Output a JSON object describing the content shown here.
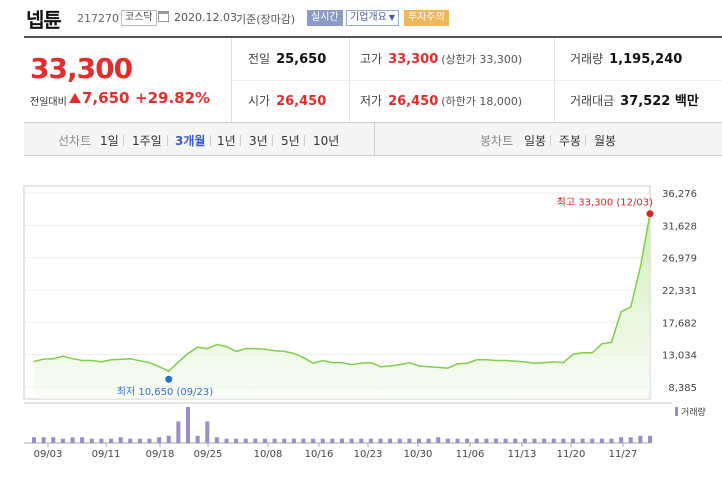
{
  "header": {
    "stock_name": "넵튠",
    "stock_code": "217270",
    "market": "코스닥",
    "as_of_date": "2020.12.03",
    "as_of_note": "기준(장마감)",
    "realtime_label": "실시간",
    "company_info_label": "기업개요",
    "warning_label": "투자주의"
  },
  "quote": {
    "current_price": "33,300",
    "change_label": "전일대비",
    "change_value": "7,650",
    "change_percent": "+29.82%",
    "prev_close_label": "전일",
    "prev_close": "25,650",
    "open_label": "시가",
    "open": "26,450",
    "high_label": "고가",
    "high": "33,300",
    "upper_limit": "(상한가 33,300)",
    "low_label": "저가",
    "low": "26,450",
    "lower_limit": "(하한가 18,000)",
    "volume_label": "거래량",
    "volume": "1,195,240",
    "amount_label": "거래대금",
    "amount": "37,522 백만"
  },
  "period_bar": {
    "line_label": "선차트",
    "line_tabs": [
      "1일",
      "1주일",
      "3개월",
      "1년",
      "3년",
      "5년",
      "10년"
    ],
    "active_tab": "3개월",
    "candle_label": "봉차트",
    "candle_tabs": [
      "일봉",
      "주봉",
      "월봉"
    ]
  },
  "colors": {
    "up": "#e42c2c",
    "line": "#7fcf4a",
    "volume": "#9b8dc8",
    "low_marker": "#2a6fd6",
    "high_marker": "#e02020"
  },
  "chart_data": {
    "type": "line",
    "title": "",
    "y_ticks": [
      "36,276",
      "31,628",
      "26,979",
      "22,331",
      "17,682",
      "13,034",
      "8,385"
    ],
    "ylim": [
      8385,
      36276
    ],
    "x_ticks": [
      "09/03",
      "09/11",
      "09/18",
      "09/25",
      "10/08",
      "10/16",
      "10/23",
      "10/30",
      "11/06",
      "11/13",
      "11/20",
      "11/27"
    ],
    "high_annotation": "최고 33,300 (12/03)",
    "low_annotation": "최저 10,650 (09/23)",
    "volume_legend": "거래량",
    "series": [
      {
        "values": [
          12050,
          12400,
          12450,
          12800,
          12450,
          12200,
          12200,
          12000,
          12300,
          12350,
          12450,
          12150,
          11900,
          11300,
          10650,
          12000,
          13200,
          14100,
          13900,
          14500,
          14200,
          13500,
          13900,
          13900,
          13800,
          13600,
          13500,
          13200,
          12600,
          11800,
          12200,
          11900,
          11900,
          11600,
          11800,
          11900,
          11300,
          11400,
          11600,
          11900,
          11400,
          11300,
          11200,
          11100,
          11700,
          11800,
          12300,
          12300,
          12200,
          12200,
          12100,
          12000,
          11800,
          11900,
          12000,
          11900,
          13100,
          13300,
          13300,
          14600,
          14800,
          19200,
          19900,
          25650,
          33300
        ]
      }
    ],
    "volume": [
      0.16,
      0.16,
      0.16,
      0.12,
      0.16,
      0.16,
      0.12,
      0.12,
      0.12,
      0.16,
      0.12,
      0.12,
      0.12,
      0.16,
      0.2,
      0.6,
      1.0,
      0.2,
      0.6,
      0.16,
      0.12,
      0.12,
      0.12,
      0.12,
      0.12,
      0.12,
      0.12,
      0.12,
      0.12,
      0.12,
      0.12,
      0.12,
      0.12,
      0.12,
      0.12,
      0.12,
      0.12,
      0.12,
      0.12,
      0.12,
      0.12,
      0.12,
      0.16,
      0.12,
      0.12,
      0.12,
      0.12,
      0.12,
      0.12,
      0.12,
      0.12,
      0.12,
      0.12,
      0.12,
      0.12,
      0.12,
      0.12,
      0.12,
      0.12,
      0.12,
      0.12,
      0.16,
      0.16,
      0.2,
      0.2
    ]
  }
}
